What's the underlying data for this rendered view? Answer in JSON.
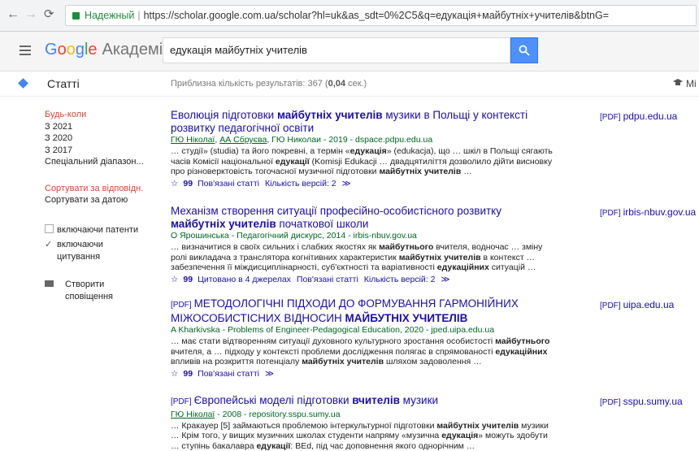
{
  "browser": {
    "secure_label": "Надежный",
    "url": "https://scholar.google.com.ua/scholar?hl=uk&as_sdt=0%2C5&q=едукація+майбутніх+учителів&btnG="
  },
  "header": {
    "logo_google": [
      "G",
      "o",
      "o",
      "g",
      "l",
      "e"
    ],
    "logo_product": "Академія",
    "search_value": "едукація майбутніх учителів"
  },
  "subbar": {
    "section": "Статті",
    "count_prefix": "Приблизна кількість результатів: 367 (",
    "count_time": "0,04",
    "count_suffix": " сек.)",
    "mine_label": "Мі"
  },
  "sidebar": {
    "time_filters": [
      "Будь-коли",
      "З 2021",
      "З 2020",
      "З 2017",
      "Спеціальний діапазон..."
    ],
    "sort_options": [
      "Сортувати за відповідн.",
      "Сортувати за датою"
    ],
    "include_patents": "включаючи патенти",
    "include_citations": "включаючи цитування",
    "create_alert": "Створити сповіщення"
  },
  "results": [
    {
      "title_html": "Еволюція підготовки <b>майбутніх учителів</b> музики в Польщі у контексті розвитку педагогічної освіти",
      "meta_html": "<u>ГЮ Ніколаї</u>, <u>АА Сбруєва</u>, ГЮ Николаи - 2019 - dspace.pdpu.edu.ua",
      "snippet_html": "… студії» (studia) та його покревні, а термін «<b>едукація</b>» (edukacja), що … шкіл в Польщі сягають часів Комісії національної <b>едукації</b> (Komisji Edukacji … двадцятиліття дозволило дійти висновку про різноверктовість тогочасної музичної підготовки <b>майбутніх учителів</b> …",
      "links": [
        "Пов'язані статті",
        "Кількість версій: 2"
      ],
      "side_tag": "[PDF]",
      "side_domain": "pdpu.edu.ua"
    },
    {
      "title_html": "Механізм створення ситуації професійно-особистісного розвитку <b>майбутніх учителів</b> початкової школи",
      "meta_html": "О Ярошинська - Педагогічний дискурс, 2014 - irbis-nbuv.gov.ua",
      "snippet_html": "… визначитися в своїх сильних і слабких якостях як <b>майбутнього</b> вчителя, водночас … зміну ролі викладача з транслятора когнітивних характеристик <b>майбутніх учителів</b> в контекст … забезпечення її міждисциплінарності, суб'єктності та варіативності <b>едукаційних</b> ситуацій …",
      "links": [
        "Цитовано в 4 джерелах",
        "Пов'язані статті",
        "Кількість версій: 2"
      ],
      "side_tag": "[PDF]",
      "side_domain": "irbis-nbuv.gov.ua"
    },
    {
      "title_prefix": "[PDF]",
      "title_html": "МЕТОДОЛОГІЧНІ ПІДХОДИ ДО ФОРМУВАННЯ ГАРМОНІЙНИХ МІЖОСОБИСТІСНИХ ВІДНОСИН <b>МАЙБУТНІХ УЧИТЕЛІВ</b>",
      "meta_html": "A Kharkivska - Problems of Engineer-Pedagogical Education, 2020 - jped.uipa.edu.ua",
      "snippet_html": "… має стати відтворенням ситуації духовного культурного зростання особистості <b>майбутнього</b> вчителя, а … підходу у контексті проблеми дослідження полягає в спрямованості <b>едукаційних</b> впливів на розкриття потенціалу <b>майбутніх учителів</b> шляхом задоволення …",
      "links": [
        "Пов'язані статті"
      ],
      "side_tag": "[PDF]",
      "side_domain": "uipa.edu.ua"
    },
    {
      "title_prefix": "[PDF]",
      "title_html": "Європейські моделі підготовки <b>вчителів</b> музики",
      "meta_html": "<u>ГЮ Ніколаї</u> - 2008 - repository.sspu.sumy.ua",
      "snippet_html": "… Кракауер [5] займаються проблемою інтеркультурної підготовки <b>майбутніх учителів</b> музики … Крім того, у вищих музичних школах студенти напряму «музична <b>едукація</b>» можуть здобути … ступінь бакалавра <b>едукації</b>: BEd, під час доповнення якого однорічним …",
      "links": [],
      "side_tag": "[PDF]",
      "side_domain": "sspu.sumy.ua"
    }
  ]
}
